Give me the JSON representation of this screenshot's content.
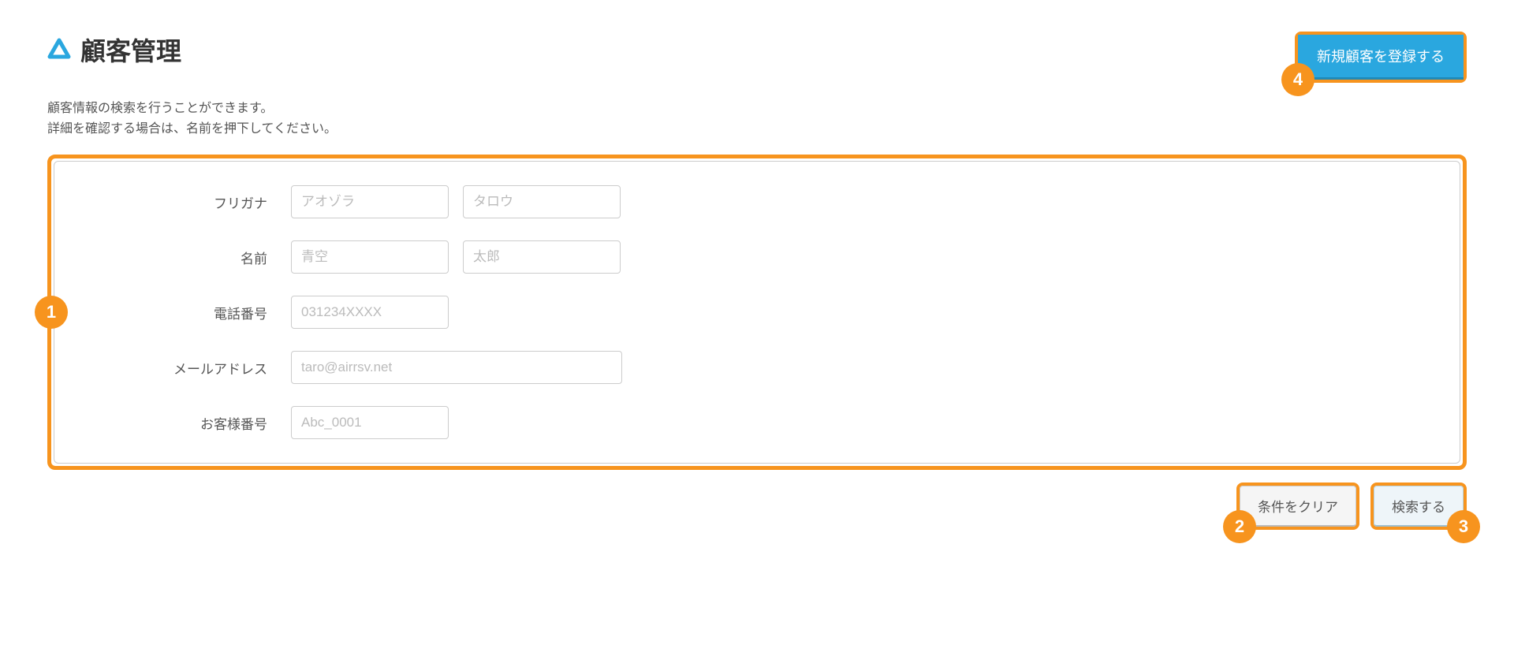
{
  "header": {
    "title": "顧客管理",
    "register_button": "新規顧客を登録する"
  },
  "description": {
    "line1": "顧客情報の検索を行うことができます。",
    "line2": "詳細を確認する場合は、名前を押下してください。"
  },
  "form": {
    "furigana": {
      "label": "フリガナ",
      "placeholder_last": "アオゾラ",
      "placeholder_first": "タロウ"
    },
    "name": {
      "label": "名前",
      "placeholder_last": "青空",
      "placeholder_first": "太郎"
    },
    "phone": {
      "label": "電話番号",
      "placeholder": "031234XXXX"
    },
    "email": {
      "label": "メールアドレス",
      "placeholder": "taro@airrsv.net"
    },
    "customer_no": {
      "label": "お客様番号",
      "placeholder": "Abc_0001"
    }
  },
  "buttons": {
    "clear": "条件をクリア",
    "search": "検索する"
  },
  "badges": {
    "b1": "1",
    "b2": "2",
    "b3": "3",
    "b4": "4"
  }
}
